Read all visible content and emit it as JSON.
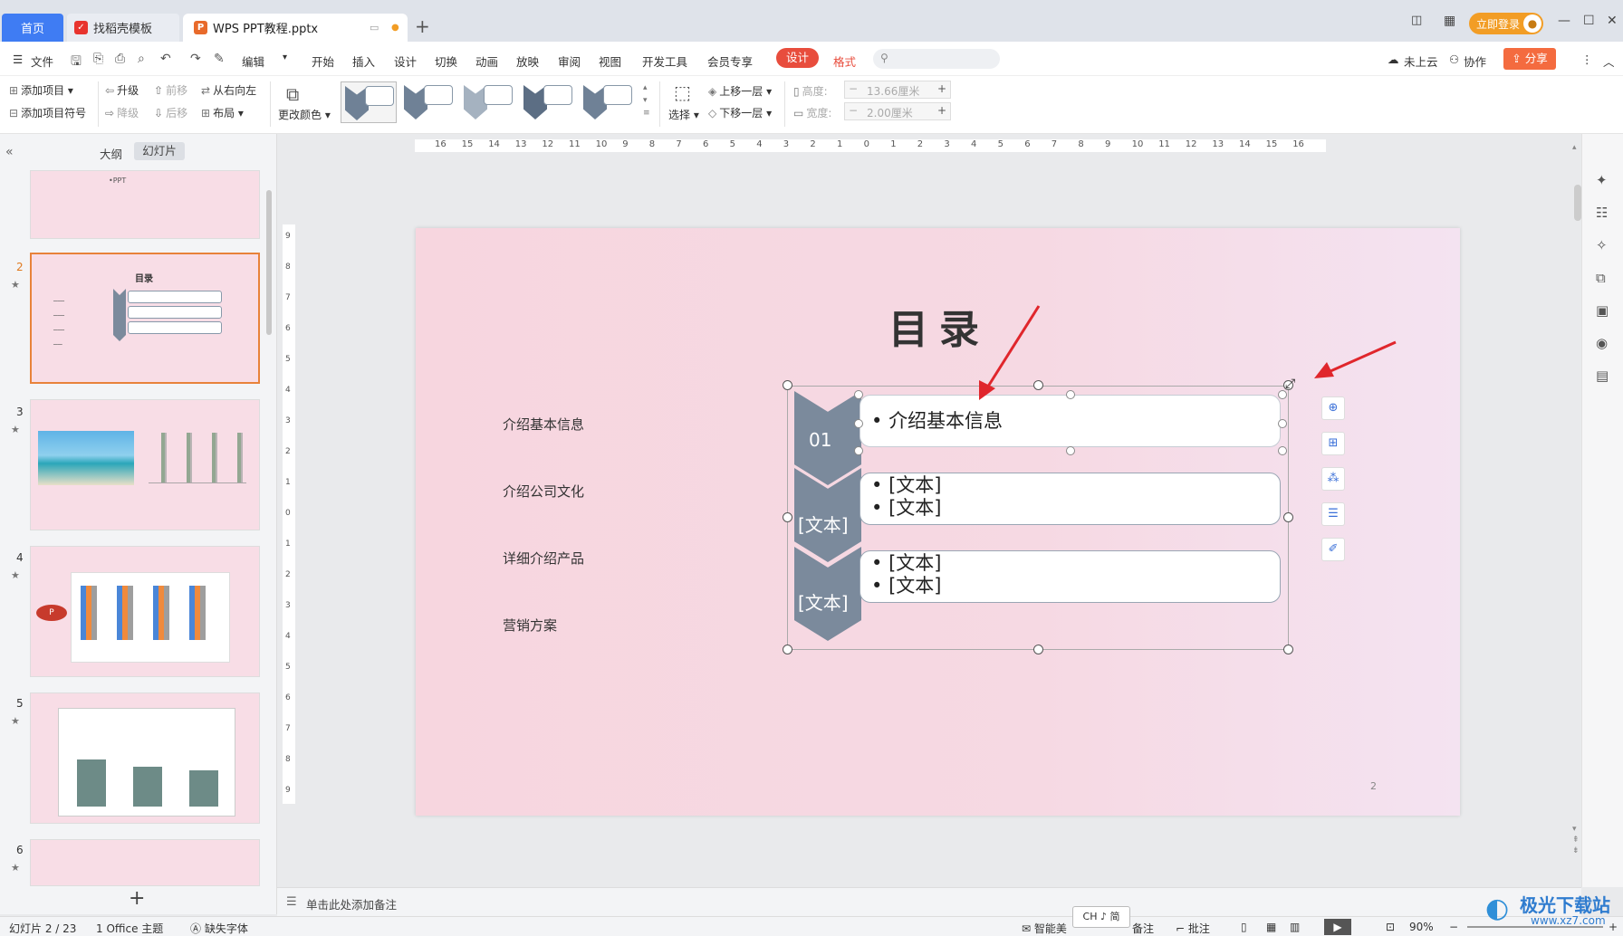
{
  "tabs": {
    "home": "首页",
    "template": "找稻壳模板",
    "document": "WPS PPT教程.pptx",
    "add": "+"
  },
  "topright": {
    "login": "立即登录"
  },
  "menu": {
    "file": "文件",
    "edit": "编辑",
    "items": [
      "开始",
      "插入",
      "设计",
      "切换",
      "动画",
      "放映",
      "审阅",
      "视图",
      "开发工具",
      "会员专享"
    ],
    "design": "设计",
    "format": "格式",
    "cloud": "未上云",
    "collab": "协作",
    "share": "分享"
  },
  "ribbon": {
    "add_item": "添加项目",
    "add_bullet": "添加项目符号",
    "promote": "升级",
    "demote": "降级",
    "move_forward": "前移",
    "move_back": "后移",
    "right_to_left": "从右向左",
    "layout": "布局",
    "change_color": "更改颜色",
    "select": "选择",
    "bring_forward": "上移一层",
    "send_backward": "下移一层",
    "height_label": "高度:",
    "height_value": "13.66厘米",
    "width_label": "宽度:",
    "width_value": "2.00厘米"
  },
  "pane": {
    "outline": "大纲",
    "slides": "幻灯片",
    "thumbs": [
      {
        "number": "",
        "title": "•PPT"
      },
      {
        "number": "2",
        "title": "目录"
      },
      {
        "number": "3",
        "title": ""
      },
      {
        "number": "4",
        "title": ""
      },
      {
        "number": "5",
        "title": ""
      },
      {
        "number": "6",
        "title": ""
      }
    ],
    "add": "+"
  },
  "ruler": {
    "horizontal": [
      "16",
      "15",
      "14",
      "13",
      "12",
      "11",
      "10",
      "9",
      "8",
      "7",
      "6",
      "5",
      "4",
      "3",
      "2",
      "1",
      "0",
      "1",
      "2",
      "3",
      "4",
      "5",
      "6",
      "7",
      "8",
      "9",
      "10",
      "11",
      "12",
      "13",
      "14",
      "15",
      "16"
    ],
    "vertical": [
      "9",
      "8",
      "7",
      "6",
      "5",
      "4",
      "3",
      "2",
      "1",
      "0",
      "1",
      "2",
      "3",
      "4",
      "5",
      "6",
      "7",
      "8",
      "9"
    ]
  },
  "slide": {
    "title": "目录",
    "left_items": [
      "介绍基本信息",
      "介绍公司文化",
      "详细介绍产品",
      "营销方案"
    ],
    "smartart": [
      {
        "badge": "01",
        "lines": [
          "介绍基本信息"
        ]
      },
      {
        "badge": "[文本]",
        "lines": [
          "[文本]",
          "[文本]"
        ]
      },
      {
        "badge": "[文本]",
        "lines": [
          "[文本]",
          "[文本]"
        ]
      }
    ],
    "page_number": "2"
  },
  "notes": {
    "placeholder": "单击此处添加备注"
  },
  "status": {
    "slide_count": "幻灯片 2 / 23",
    "theme": "1 Office 主题",
    "missing_font": "缺失字体",
    "smart": "智能美",
    "ime": "CH ♪ 简",
    "remarks": "备注",
    "comments": "批注",
    "zoom": "90%"
  },
  "watermark": {
    "name": "极光下载站",
    "url": "www.xz7.com"
  },
  "colors": {
    "accent": "#3f7cf3",
    "chevron": "#7b8a9c",
    "design_tab": "#e84d3d",
    "share": "#f46b3f",
    "arrow": "#e0262c"
  }
}
